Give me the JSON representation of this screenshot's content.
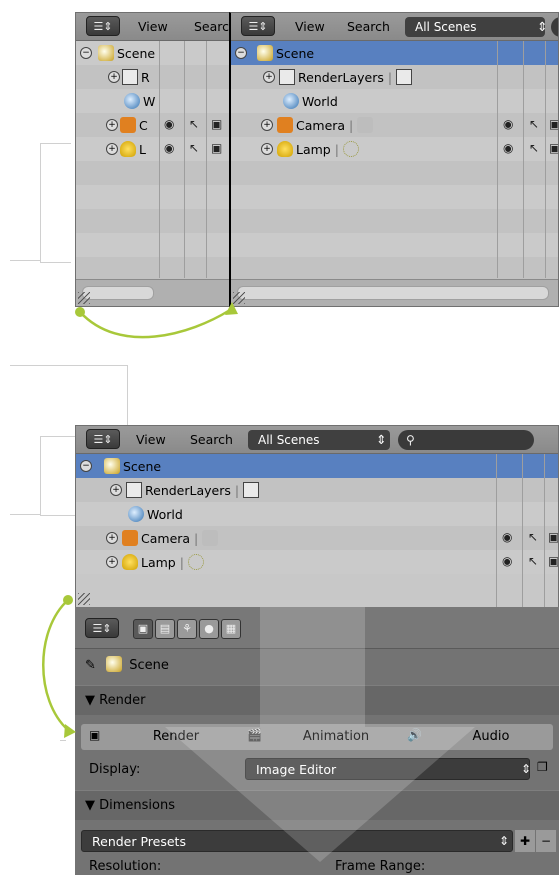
{
  "top_left_outliner": {
    "header": {
      "view_label": "View",
      "search_label": "Searc"
    },
    "rows": [
      {
        "label": "Scene"
      },
      {
        "label": "R"
      },
      {
        "label": "W"
      },
      {
        "label": "C"
      },
      {
        "label": "L"
      }
    ]
  },
  "top_right_outliner": {
    "header": {
      "view_label": "View",
      "search_label": "Search",
      "scene_filter": "All Scenes"
    },
    "rows": [
      {
        "label": "Scene"
      },
      {
        "label": "RenderLayers"
      },
      {
        "label": "World"
      },
      {
        "label": "Camera"
      },
      {
        "label": "Lamp"
      }
    ]
  },
  "merged_outliner": {
    "header": {
      "view_label": "View",
      "search_label": "Search",
      "scene_filter": "All Scenes",
      "search_value": ""
    },
    "rows": [
      {
        "label": "Scene"
      },
      {
        "label": "RenderLayers"
      },
      {
        "label": "World"
      },
      {
        "label": "Camera"
      },
      {
        "label": "Lamp"
      }
    ]
  },
  "properties": {
    "breadcrumb": "Scene",
    "render_panel_title": "Render",
    "render_buttons": {
      "render": "Render",
      "animation": "Animation",
      "audio": "Audio"
    },
    "display_label": "Display:",
    "display_value": "Image Editor",
    "dimensions_panel_title": "Dimensions",
    "render_presets": "Render Presets",
    "resolution_label": "Resolution:",
    "frame_range_label": "Frame Range:"
  },
  "colors": {
    "selection": "#5880c0",
    "arrow": "#a8c83a"
  }
}
